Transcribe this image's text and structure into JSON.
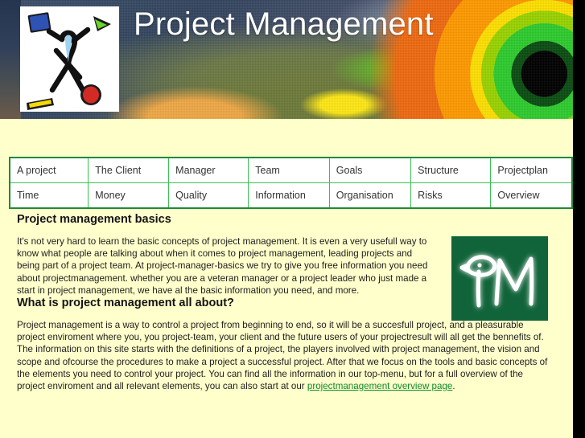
{
  "site": {
    "banner_title": "Project Management",
    "logo_alt": "juggling-stick-figure-logo",
    "pm_badge_text": "PM"
  },
  "nav": {
    "rows": [
      [
        {
          "label": "A project"
        },
        {
          "label": "The Client"
        },
        {
          "label": "Manager"
        },
        {
          "label": "Team"
        },
        {
          "label": "Goals"
        },
        {
          "label": "Structure"
        },
        {
          "label": "Projectplan"
        }
      ],
      [
        {
          "label": "Time"
        },
        {
          "label": "Money"
        },
        {
          "label": "Quality"
        },
        {
          "label": "Information"
        },
        {
          "label": "Organisation"
        },
        {
          "label": "Risks"
        },
        {
          "label": "Overview"
        }
      ]
    ]
  },
  "sections": [
    {
      "heading": "Project management basics",
      "body": "It's not very hard to learn the basic concepts of project management. It is even a very usefull way to know what people are talking about when it comes to project management, leading projects and being part of a project team. At project-manager-basics we try to give you free information you need about projectmanagement. whether you are a veteran manager or a project leader who just made a start in project management, we have al the basic information you need, and more."
    },
    {
      "heading": "What is project management all about?",
      "body_before_link": "Project management is a way to control a project from beginning to end, so it will be a succesfull project, and a pleasurable project enviroment where you, you project-team, your client and the future users of your projectresult will all get the bennefits of. The information on this site starts with the definitions of a project, the players involved with project management, the vision and scope and ofcourse the procedures to make a project a successful project. After that we focus on the tools and basic concepts of the elements you need to control your project. You can find all the information in our top-menu, but for a full overview of the project enviroment and all relevant elements, you can also start at our ",
      "link_text": "projectmanagement overview page",
      "body_after_link": "."
    }
  ],
  "colors": {
    "page_background": "#FFFFCC",
    "nav_border": "#3bbf55",
    "nav_outer_border": "#1f8a3c",
    "link": "#0a8a2a",
    "pm_badge_bg": "#11643a",
    "heading": "#141414"
  }
}
